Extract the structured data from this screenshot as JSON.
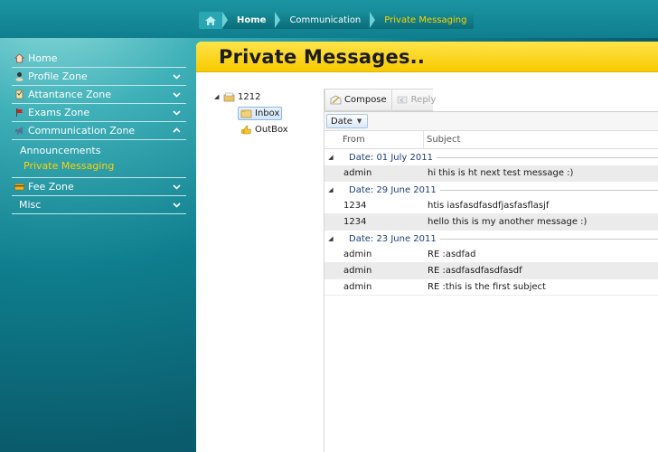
{
  "breadcrumb": {
    "items": [
      "Home",
      "Communication",
      "Private Messaging"
    ]
  },
  "sidebar": {
    "items": [
      {
        "label": "Home",
        "icon": "house-icon"
      },
      {
        "label": "Profile Zone",
        "icon": "profile-icon",
        "expanded": false
      },
      {
        "label": "Attantance Zone",
        "icon": "attendance-icon",
        "expanded": false
      },
      {
        "label": "Exams Zone",
        "icon": "flag-icon",
        "expanded": false
      },
      {
        "label": "Communication Zone",
        "icon": "megaphone-icon",
        "expanded": true
      },
      {
        "label": "Fee Zone",
        "icon": "card-icon",
        "expanded": false
      },
      {
        "label": "Misc",
        "expanded": false
      }
    ],
    "communication_sub": [
      "Announcements",
      "Private Messaging"
    ]
  },
  "panel": {
    "title": "Private Messages.."
  },
  "tree": {
    "root": "1212",
    "children": [
      "Inbox",
      "OutBox"
    ]
  },
  "toolbar": {
    "compose_label": "Compose",
    "reply_label": "Reply"
  },
  "grouping": {
    "chip": "Date"
  },
  "columns": {
    "from": "From",
    "subject": "Subject"
  },
  "groups": [
    {
      "label": "Date: 01 July 2011",
      "rows": [
        {
          "from": "admin",
          "subject": "hi this is ht next test message :)"
        }
      ]
    },
    {
      "label": "Date: 29 June 2011",
      "rows": [
        {
          "from": "1234",
          "subject": "htis iasfasdfasdfjasfasflasjf"
        },
        {
          "from": "1234",
          "subject": "hello this is my another message :)"
        }
      ]
    },
    {
      "label": "Date: 23 June 2011",
      "rows": [
        {
          "from": "admin",
          "subject": "RE :asdfad"
        },
        {
          "from": "admin",
          "subject": "RE :asdfasdfasdfasdf"
        },
        {
          "from": "admin",
          "subject": "RE :this is the first subject"
        }
      ]
    }
  ],
  "colors": {
    "accent_yellow": "#ffd200",
    "header_yellow": "#f7c900",
    "teal": "#0f7e8e",
    "group_text": "#1c3e7c"
  }
}
